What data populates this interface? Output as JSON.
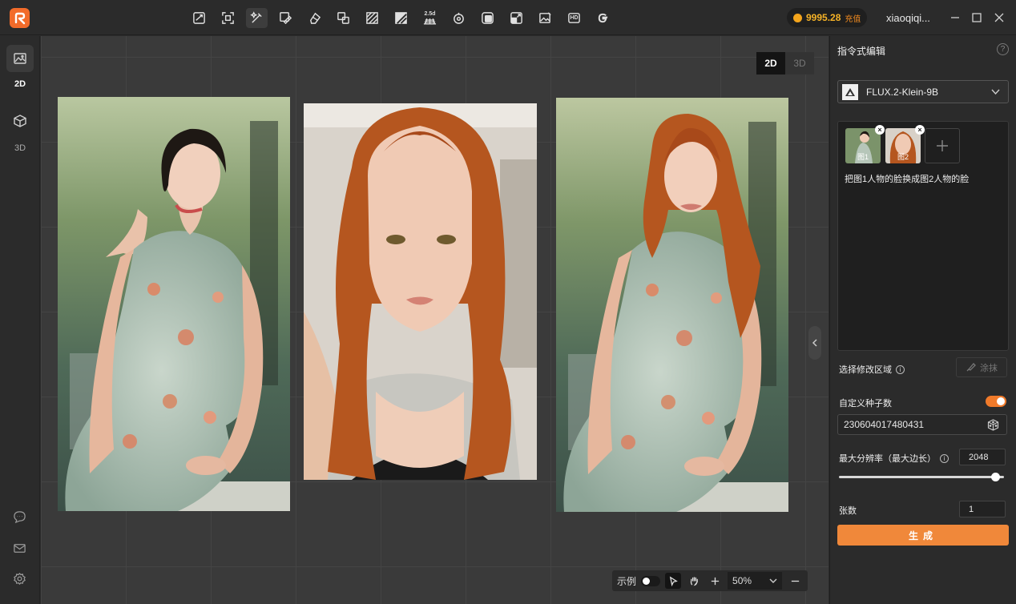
{
  "topbar": {
    "credits": {
      "amount": "9995.28",
      "recharge_label": "充值"
    },
    "username": "xiaoqiqi...",
    "tools": [
      "crop-icon",
      "scan-icon",
      "magic-wand-icon",
      "edit-image-icon",
      "eraser-icon",
      "transform-icon",
      "stripes-icon",
      "slash-pattern-icon",
      "2.5d-grid-icon",
      "rotate-icon",
      "layers-icon",
      "expand-icon",
      "image-edit-icon",
      "hd-icon",
      "g-logo-icon"
    ],
    "tool_2_5d_label": "2.5d",
    "tool_hd_label": "HD"
  },
  "sidebar": {
    "items": [
      {
        "label": "2D",
        "icon": "image-icon",
        "active": true
      },
      {
        "label": "3D",
        "icon": "cube-icon",
        "active": false
      }
    ],
    "bottom_icons": [
      "chat-icon",
      "mail-icon",
      "settings-icon"
    ]
  },
  "canvas": {
    "view_toggle": {
      "on": "2D",
      "off": "3D"
    },
    "images": [
      {
        "name": "image-woman-qipao-black-hair"
      },
      {
        "name": "image-woman-red-hair-selfie"
      },
      {
        "name": "image-result-red-hair-qipao"
      }
    ],
    "bottom_bar": {
      "example_label": "示例",
      "zoom": "50%"
    }
  },
  "panel": {
    "title": "指令式编辑",
    "model": "FLUX.2-Klein-9B",
    "references": [
      {
        "label": "图1"
      },
      {
        "label": "图2"
      }
    ],
    "prompt": "把图1人物的脸换成图2人物的脸",
    "select_area_label": "选择修改区域",
    "smear_label": "涂抹",
    "seed_label": "自定义种子数",
    "seed_enabled": true,
    "seed_value": "230604017480431",
    "max_res_label": "最大分辨率（最大边长）",
    "max_res_value": "2048",
    "count_label": "张数",
    "count_value": "1",
    "generate_label": "生成",
    "accent_color": "#f0883a"
  }
}
